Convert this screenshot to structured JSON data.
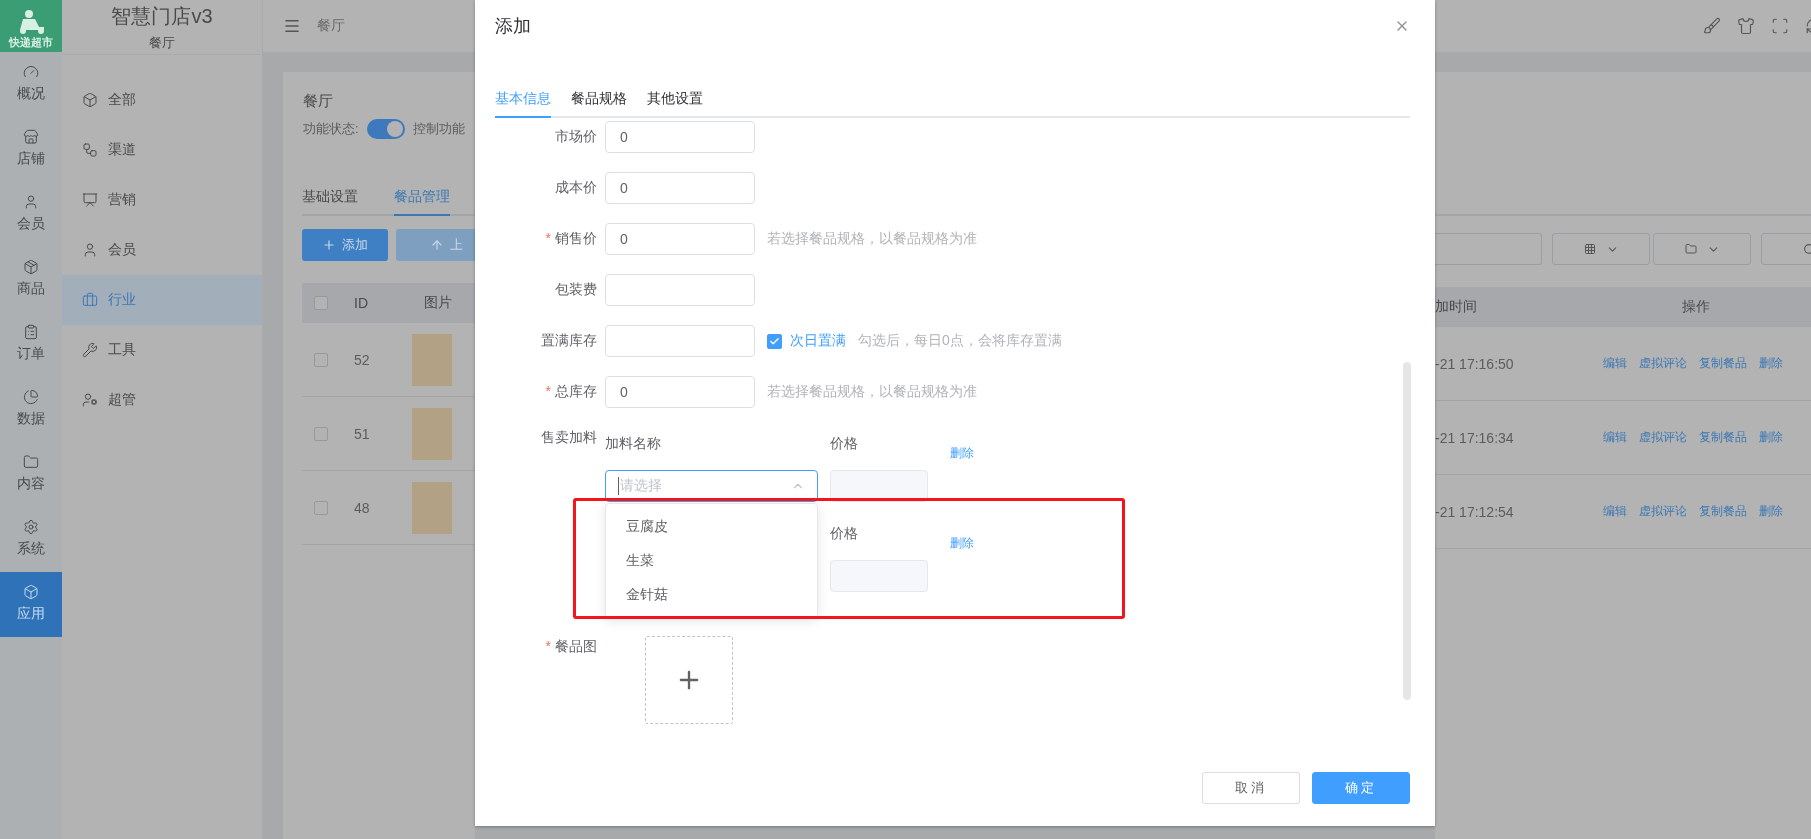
{
  "rail": {
    "logo_text": "快递超市",
    "items": [
      {
        "label": "概况",
        "selected": false
      },
      {
        "label": "店铺",
        "selected": false
      },
      {
        "label": "会员",
        "selected": false
      },
      {
        "label": "商品",
        "selected": false
      },
      {
        "label": "订单",
        "selected": false
      },
      {
        "label": "数据",
        "selected": false
      },
      {
        "label": "内容",
        "selected": false
      },
      {
        "label": "系统",
        "selected": false
      },
      {
        "label": "应用",
        "selected": true
      }
    ]
  },
  "sidebar": {
    "title": "智慧门店v3",
    "subtitle": "餐厅",
    "items": [
      {
        "label": "全部",
        "selected": false
      },
      {
        "label": "渠道",
        "selected": false
      },
      {
        "label": "营销",
        "selected": false
      },
      {
        "label": "会员",
        "selected": false
      },
      {
        "label": "行业",
        "selected": true
      },
      {
        "label": "工具",
        "selected": false
      },
      {
        "label": "超管",
        "selected": false
      }
    ]
  },
  "topbar": {
    "breadcrumb": "餐厅"
  },
  "plugin_card": {
    "title": "餐厅",
    "status_label": "功能状态:",
    "status_on": true,
    "status_note": "控制功能"
  },
  "page_tabs": [
    {
      "label": "基础设置",
      "selected": false
    },
    {
      "label": "餐品管理",
      "selected": true
    }
  ],
  "toolbar_buttons": [
    {
      "label": "添加",
      "kind": "add"
    },
    {
      "label": "上",
      "kind": "upload"
    }
  ],
  "table": {
    "header_checked": false,
    "columns_left": [
      "ID",
      "图片"
    ],
    "columns_right": [
      "加时间",
      "操作"
    ],
    "rows": [
      {
        "checked": false,
        "id": "52",
        "time": "-21 17:16:50",
        "actions": [
          "编辑",
          "虚拟评论",
          "复制餐品",
          "删除"
        ]
      },
      {
        "checked": false,
        "id": "51",
        "time": "-21 17:16:34",
        "actions": [
          "编辑",
          "虚拟评论",
          "复制餐品",
          "删除"
        ]
      },
      {
        "checked": false,
        "id": "48",
        "time": "-21 17:12:54",
        "actions": [
          "编辑",
          "虚拟评论",
          "复制餐品",
          "删除"
        ]
      }
    ]
  },
  "dialog": {
    "title": "添加",
    "tabs": [
      {
        "label": "基本信息",
        "selected": true
      },
      {
        "label": "餐品规格",
        "selected": false
      },
      {
        "label": "其他设置",
        "selected": false
      }
    ],
    "fields": [
      {
        "label": "市场价",
        "value": "0"
      },
      {
        "label": "成本价",
        "value": "0"
      },
      {
        "label": "销售价",
        "required_mark": "*",
        "value": "0",
        "hint": "若选择餐品规格，以餐品规格为准"
      },
      {
        "label": "包装费"
      },
      {
        "label": "置满库存",
        "checkbox": {
          "label": "次日置满",
          "checked": true
        },
        "hint": "勾选后，每日0点，会将库存置满"
      },
      {
        "label": "总库存",
        "required_mark": "*",
        "value": "0",
        "hint": "若选择餐品规格，以餐品规格为准"
      }
    ],
    "addons": {
      "label": "售卖加料",
      "rows": [
        {
          "name_header": "加料名称",
          "price_header": "价格",
          "placeholder": "请选择",
          "open": true,
          "price_disabled": true,
          "delete": "删除"
        },
        {
          "price_header": "价格",
          "price_disabled": true,
          "delete": "删除"
        }
      ],
      "options": [
        "豆腐皮",
        "生菜",
        "金针菇"
      ]
    },
    "image_field": {
      "label": "餐品图",
      "required_mark": "*"
    },
    "buttons": [
      {
        "label": "取消",
        "kind": "default"
      },
      {
        "label": "确定",
        "kind": "primary"
      }
    ]
  }
}
